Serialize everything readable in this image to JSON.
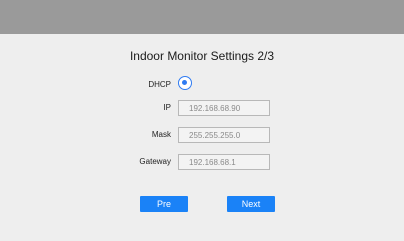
{
  "page": {
    "title": "Indoor Monitor Settings 2/3"
  },
  "form": {
    "dhcp": {
      "label": "DHCP",
      "selected": true
    },
    "ip": {
      "label": "IP",
      "value": "192.168.68.90"
    },
    "mask": {
      "label": "Mask",
      "value": "255.255.255.0"
    },
    "gateway": {
      "label": "Gateway",
      "value": "192.168.68.1"
    }
  },
  "buttons": {
    "prev_label": "Pre",
    "next_label": "Next"
  },
  "colors": {
    "accent": "#1a82f7",
    "top_bar": "#9a9a9a",
    "background": "#eeeeee"
  }
}
